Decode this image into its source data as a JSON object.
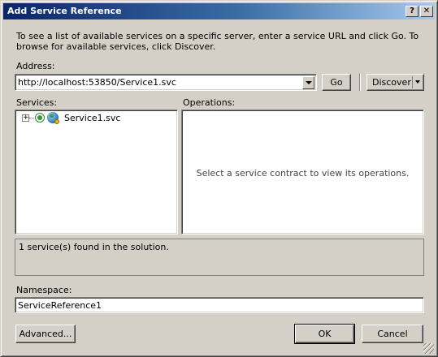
{
  "window": {
    "title": "Add Service Reference",
    "help_button": "?",
    "close_button": "✕"
  },
  "description": "To see a list of available services on a specific server, enter a service URL and click Go. To browse for available services, click Discover.",
  "address": {
    "label": "Address:",
    "value": "http://localhost:53850/Service1.svc",
    "go_label": "Go",
    "discover_label": "Discover"
  },
  "services": {
    "label": "Services:",
    "items": [
      {
        "label": "Service1.svc",
        "expander": "+"
      }
    ]
  },
  "operations": {
    "label": "Operations:",
    "placeholder": "Select a service contract to view its operations."
  },
  "status": {
    "text": "1 service(s) found in the solution."
  },
  "namespace": {
    "label": "Namespace:",
    "value": "ServiceReference1"
  },
  "buttons": {
    "advanced": "Advanced...",
    "ok": "OK",
    "cancel": "Cancel"
  }
}
